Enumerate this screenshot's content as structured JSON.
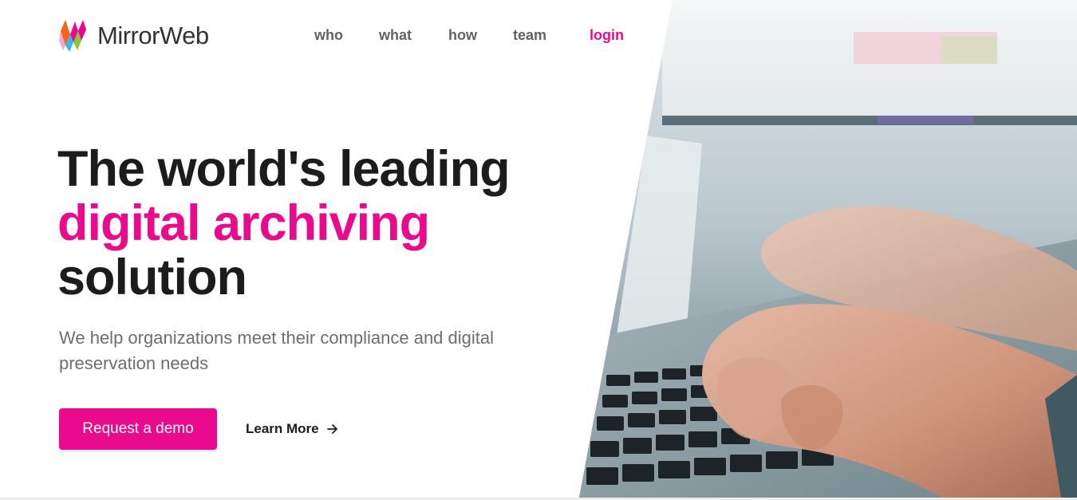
{
  "brand": {
    "name": "MirrorWeb",
    "logo_icon": "mirrorweb-logo-icon",
    "accent_color": "#ea0a8e"
  },
  "nav": {
    "items": [
      {
        "label": "who"
      },
      {
        "label": "what"
      },
      {
        "label": "how"
      },
      {
        "label": "team"
      },
      {
        "label": "login"
      }
    ]
  },
  "hero": {
    "title_line1": "The world's leading",
    "title_line2": "digital archiving",
    "title_line3": "solution",
    "subtitle": "We help organizations meet their compliance and digital preservation needs",
    "primary_button": "Request a demo",
    "secondary_link": "Learn More",
    "secondary_icon": "arrow-right-icon",
    "image": "photo-hands-typing-on-laptop"
  }
}
